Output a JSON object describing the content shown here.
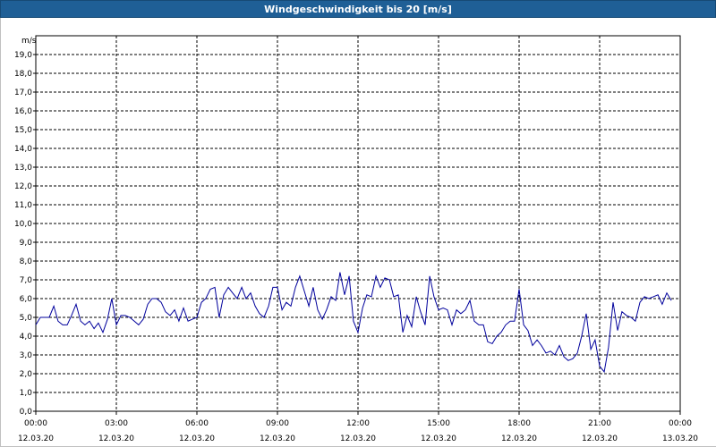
{
  "window": {
    "title": "Windgeschwindigkeit bis 20 [m/s]"
  },
  "colors": {
    "titlebar": "#1f5f96",
    "series": "#00009c",
    "grid": "#000000"
  },
  "chart_data": {
    "type": "line",
    "title": "Windgeschwindigkeit bis 20 [m/s]",
    "ylabel": "m/s",
    "xlabel": "",
    "ylim": [
      0,
      20
    ],
    "yticks": [
      "0,0",
      "1,0",
      "2,0",
      "3,0",
      "4,0",
      "5,0",
      "6,0",
      "7,0",
      "8,0",
      "9,0",
      "10,0",
      "11,0",
      "12,0",
      "13,0",
      "14,0",
      "15,0",
      "16,0",
      "17,0",
      "18,0",
      "19,0"
    ],
    "xlim_hours": [
      0,
      24
    ],
    "xticks": [
      {
        "time": "00:00",
        "date": "12.03.20"
      },
      {
        "time": "03:00",
        "date": "12.03.20"
      },
      {
        "time": "06:00",
        "date": "12.03.20"
      },
      {
        "time": "09:00",
        "date": "12.03.20"
      },
      {
        "time": "12:00",
        "date": "12.03.20"
      },
      {
        "time": "15:00",
        "date": "12.03.20"
      },
      {
        "time": "18:00",
        "date": "12.03.20"
      },
      {
        "time": "21:00",
        "date": "12.03.20"
      },
      {
        "time": "00:00",
        "date": "13.03.20"
      }
    ],
    "grid": true,
    "series": [
      {
        "x_hours": [
          0,
          0.17,
          0.33,
          0.5,
          0.67,
          0.83,
          1,
          1.17,
          1.33,
          1.5,
          1.67,
          1.83,
          2,
          2.17,
          2.33,
          2.5,
          2.67,
          2.83,
          3,
          3.17,
          3.33,
          3.5,
          3.67,
          3.83,
          4,
          4.17,
          4.33,
          4.5,
          4.67,
          4.83,
          5,
          5.17,
          5.33,
          5.5,
          5.67,
          5.83,
          6,
          6.17,
          6.33,
          6.5,
          6.67,
          6.83,
          7,
          7.17,
          7.33,
          7.5,
          7.67,
          7.83,
          8,
          8.17,
          8.33,
          8.5,
          8.67,
          8.83,
          9,
          9.17,
          9.33,
          9.5,
          9.67,
          9.83,
          10,
          10.17,
          10.33,
          10.5,
          10.67,
          10.83,
          11,
          11.17,
          11.33,
          11.5,
          11.67,
          11.83,
          12,
          12.17,
          12.33,
          12.5,
          12.67,
          12.83,
          13,
          13.17,
          13.33,
          13.5,
          13.67,
          13.83,
          14,
          14.17,
          14.33,
          14.5,
          14.67,
          14.83,
          15,
          15.17,
          15.33,
          15.5,
          15.67,
          15.83,
          16,
          16.17,
          16.33,
          16.5,
          16.67,
          16.83,
          17,
          17.17,
          17.33,
          17.5,
          17.67,
          17.83,
          18,
          18.17,
          18.33,
          18.5,
          18.67,
          18.83,
          19,
          19.17,
          19.33,
          19.5,
          19.67,
          19.83,
          20,
          20.17,
          20.33,
          20.5,
          20.67,
          20.83,
          21,
          21.17,
          21.33,
          21.5,
          21.67,
          21.83,
          22,
          22.17,
          22.33,
          22.5,
          22.67,
          22.83,
          23,
          23.17,
          23.33,
          23.5,
          23.67,
          23.83,
          24
        ],
        "values": [
          4.6,
          5.0,
          5.0,
          5.0,
          5.6,
          4.8,
          4.6,
          4.6,
          5.1,
          5.7,
          4.8,
          4.6,
          4.8,
          4.4,
          4.7,
          4.2,
          4.9,
          6.0,
          4.6,
          5.1,
          5.1,
          5.0,
          4.8,
          4.6,
          4.9,
          5.7,
          6.0,
          6.0,
          5.8,
          5.3,
          5.1,
          5.4,
          4.8,
          5.5,
          4.8,
          4.9,
          5.0,
          5.8,
          6.0,
          6.5,
          6.6,
          5.0,
          6.2,
          6.6,
          6.3,
          6.0,
          6.6,
          6.0,
          6.3,
          5.6,
          5.2,
          5.0,
          5.6,
          6.6,
          6.6,
          5.4,
          5.8,
          5.6,
          6.6,
          7.2,
          6.4,
          5.6,
          6.6,
          5.4,
          4.9,
          5.4,
          6.1,
          5.9,
          7.4,
          6.2,
          7.2,
          4.8,
          4.2,
          5.5,
          6.2,
          6.1,
          7.2,
          6.6,
          7.1,
          7.0,
          6.1,
          6.2,
          4.2,
          5.1,
          4.5,
          6.1,
          5.3,
          4.6,
          7.2,
          6.1,
          5.4,
          5.5,
          5.4,
          4.6,
          5.4,
          5.2,
          5.4,
          5.9,
          4.8,
          4.6,
          4.6,
          3.7,
          3.6,
          4.0,
          4.2,
          4.6,
          4.8,
          4.8,
          6.5,
          4.6,
          4.3,
          3.5,
          3.8,
          3.5,
          3.1,
          3.2,
          3.0,
          3.5,
          2.9,
          2.7,
          2.8,
          3.1,
          4.0,
          5.2,
          3.3,
          3.8,
          2.4,
          2.1,
          3.4,
          5.8,
          4.3,
          5.3,
          5.1,
          5.0,
          4.8,
          5.8,
          6.1,
          6.0,
          6.1,
          6.2,
          5.7,
          6.3,
          5.9
        ]
      }
    ]
  }
}
